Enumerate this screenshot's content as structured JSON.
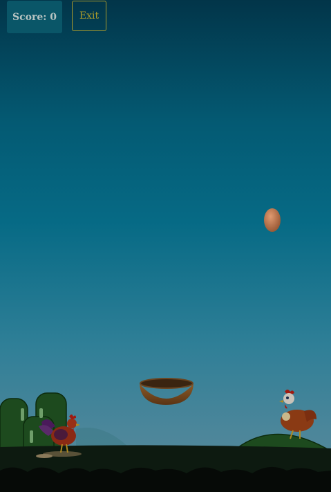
{
  "hud": {
    "score_label": "Score: 0",
    "exit_label": "Exit"
  },
  "colors": {
    "sky_top": "#023549",
    "sky_bottom": "#5a8a9a",
    "hill": "#1d4a1e",
    "ground": "#0d1a10",
    "exit_accent": "#a89a2c",
    "egg": "#c77a52",
    "basket": "#8a5a28"
  },
  "sprites": {
    "falling_egg": "egg",
    "player_basket": "basket",
    "left_character": "rooster",
    "right_character": "hen",
    "background_left": "green-pipes",
    "background_right": "green-hill"
  }
}
